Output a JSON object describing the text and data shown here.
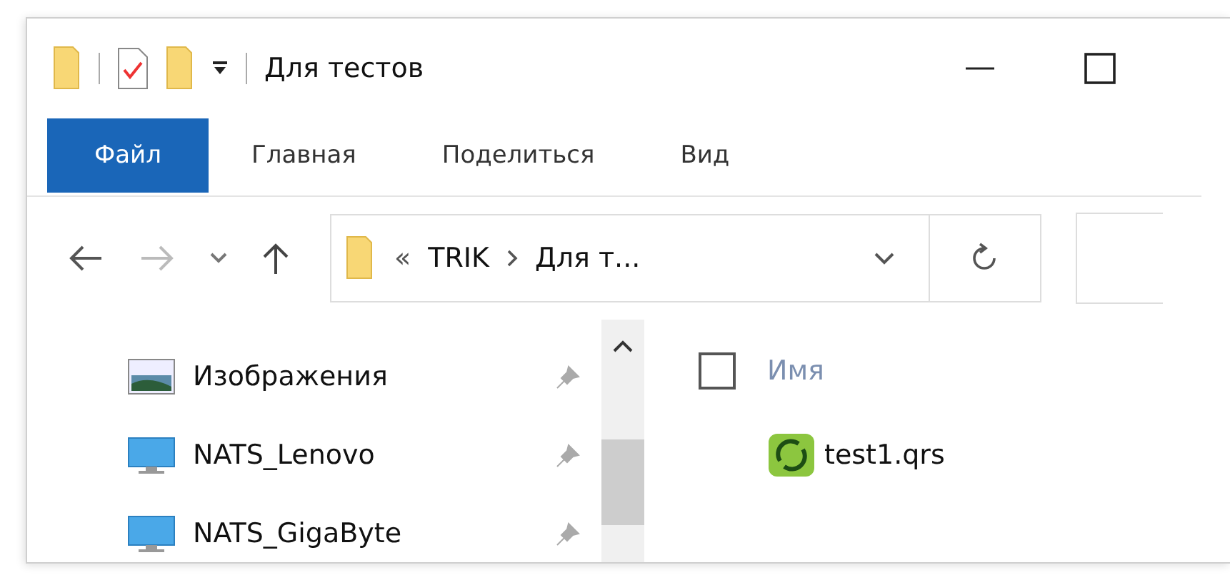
{
  "window": {
    "title": "Для тестов"
  },
  "ribbon_tabs": [
    {
      "label": "Файл",
      "selected": true
    },
    {
      "label": "Главная",
      "selected": false
    },
    {
      "label": "Поделиться",
      "selected": false
    },
    {
      "label": "Вид",
      "selected": false
    }
  ],
  "address_bar": {
    "overflow": "«",
    "segments": [
      "TRIK",
      "Для т..."
    ]
  },
  "sidebar": {
    "items": [
      {
        "label": "Изображения",
        "kind": "pictures",
        "pinned": true
      },
      {
        "label": "NATS_Lenovo",
        "kind": "computer",
        "pinned": true
      },
      {
        "label": "NATS_GigaByte",
        "kind": "computer",
        "pinned": true
      }
    ]
  },
  "file_list": {
    "select_all": {
      "checked": false
    },
    "columns": [
      "Имя"
    ],
    "rows": [
      {
        "name": "test1.qrs"
      }
    ]
  }
}
